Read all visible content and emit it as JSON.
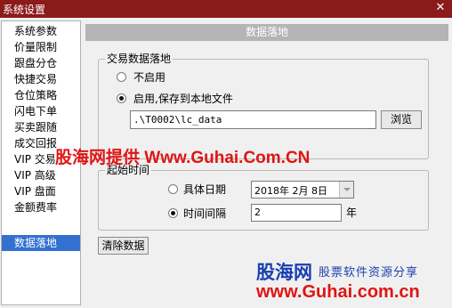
{
  "window": {
    "title": "系统设置",
    "close_glyph": "✕"
  },
  "sidebar": {
    "items": [
      {
        "label": "系统参数"
      },
      {
        "label": "价量限制"
      },
      {
        "label": "跟盘分仓"
      },
      {
        "label": "快捷交易"
      },
      {
        "label": "仓位策略"
      },
      {
        "label": "闪电下单"
      },
      {
        "label": "买卖跟随"
      },
      {
        "label": "成交回报"
      },
      {
        "label": "VIP 交易"
      },
      {
        "label": "VIP 高级"
      },
      {
        "label": "VIP 盘面"
      },
      {
        "label": "金额费率"
      },
      {
        "label": "数据落地",
        "selected": true
      }
    ]
  },
  "panel": {
    "title": "数据落地"
  },
  "trade_group": {
    "legend": "交易数据落地",
    "option_disable": "不启用",
    "option_enable": "启用,保存到本地文件",
    "selected": "enable",
    "path_value": ".\\T0002\\lc_data",
    "browse_label": "浏览"
  },
  "start_group": {
    "legend": "起始时间",
    "option_date": "具体日期",
    "date_value": "2018年 2月 8日",
    "option_interval": "时间间隔",
    "interval_value": "2",
    "interval_unit": "年",
    "selected": "interval"
  },
  "clear_button": "清除数据",
  "watermark": "股海网提供 Www.Guhai.Com.CN",
  "corner_logo": {
    "brand": "股海网",
    "slogan": "股票软件资源分享",
    "url": "www.Guhai.com.cn"
  },
  "colors": {
    "titlebar": "#8b1a1a",
    "selection": "#3370d0",
    "panel_header": "#b4b4b4",
    "watermark": "#e01414",
    "logo_blue": "#1a3fb0"
  }
}
